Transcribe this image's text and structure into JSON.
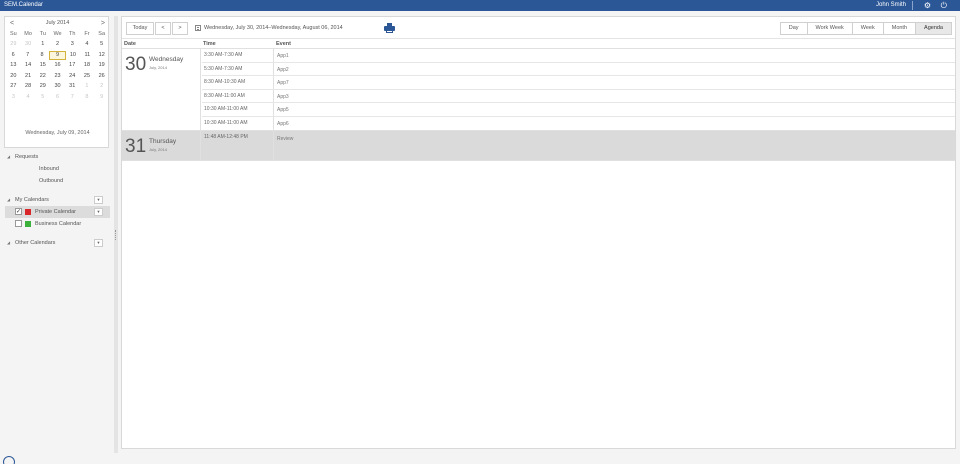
{
  "app": {
    "title": "SEM.Calendar",
    "user": "John Smith"
  },
  "mini_calendar": {
    "month_label": "July 2014",
    "prev": "<",
    "next": ">",
    "weekdays": [
      "Su",
      "Mo",
      "Tu",
      "We",
      "Th",
      "Fr",
      "Sa"
    ],
    "weeks": [
      [
        "29",
        "30",
        "1",
        "2",
        "3",
        "4",
        "5"
      ],
      [
        "6",
        "7",
        "8",
        "9",
        "10",
        "11",
        "12"
      ],
      [
        "13",
        "14",
        "15",
        "16",
        "17",
        "18",
        "19"
      ],
      [
        "20",
        "21",
        "22",
        "23",
        "24",
        "25",
        "26"
      ],
      [
        "27",
        "28",
        "29",
        "30",
        "31",
        "1",
        "2"
      ],
      [
        "3",
        "4",
        "5",
        "6",
        "7",
        "8",
        "9"
      ]
    ],
    "footer": "Wednesday, July 09, 2014"
  },
  "tree": {
    "requests": {
      "label": "Requests",
      "children": [
        "Inbound",
        "Outbound"
      ]
    },
    "my_calendars": {
      "label": "My Calendars",
      "items": [
        {
          "name": "Private Calendar",
          "color": "#d9262b",
          "checked": "✓"
        },
        {
          "name": "Business Calendar",
          "color": "#3bb13b",
          "checked": ""
        }
      ]
    },
    "other_calendars": {
      "label": "Other Calendars"
    }
  },
  "toolbar": {
    "today": "Today",
    "prev": "<",
    "next": ">",
    "range": "Wednesday, July 30, 2014–Wednesday, August 06, 2014",
    "views": [
      "Day",
      "Work Week",
      "Week",
      "Month",
      "Agenda"
    ],
    "active_view": "Agenda"
  },
  "agenda": {
    "headers": {
      "date": "Date",
      "time": "Time",
      "event": "Event"
    },
    "days": [
      {
        "num": "30",
        "name": "Wednesday",
        "month": "July, 2014",
        "events": [
          {
            "time": "3:30 AM-7:30 AM",
            "name": "App1"
          },
          {
            "time": "5:30 AM-7:30 AM",
            "name": "App2"
          },
          {
            "time": "8:30 AM-10:30 AM",
            "name": "App7"
          },
          {
            "time": "8:30 AM-11:00 AM",
            "name": "App3"
          },
          {
            "time": "10:30 AM-11:00 AM",
            "name": "App5"
          },
          {
            "time": "10:30 AM-11:00 AM",
            "name": "App6"
          }
        ]
      },
      {
        "num": "31",
        "name": "Thursday",
        "month": "July, 2014",
        "events": [
          {
            "time": "11:48 AM-12:48 PM",
            "name": "Review"
          }
        ]
      }
    ]
  }
}
